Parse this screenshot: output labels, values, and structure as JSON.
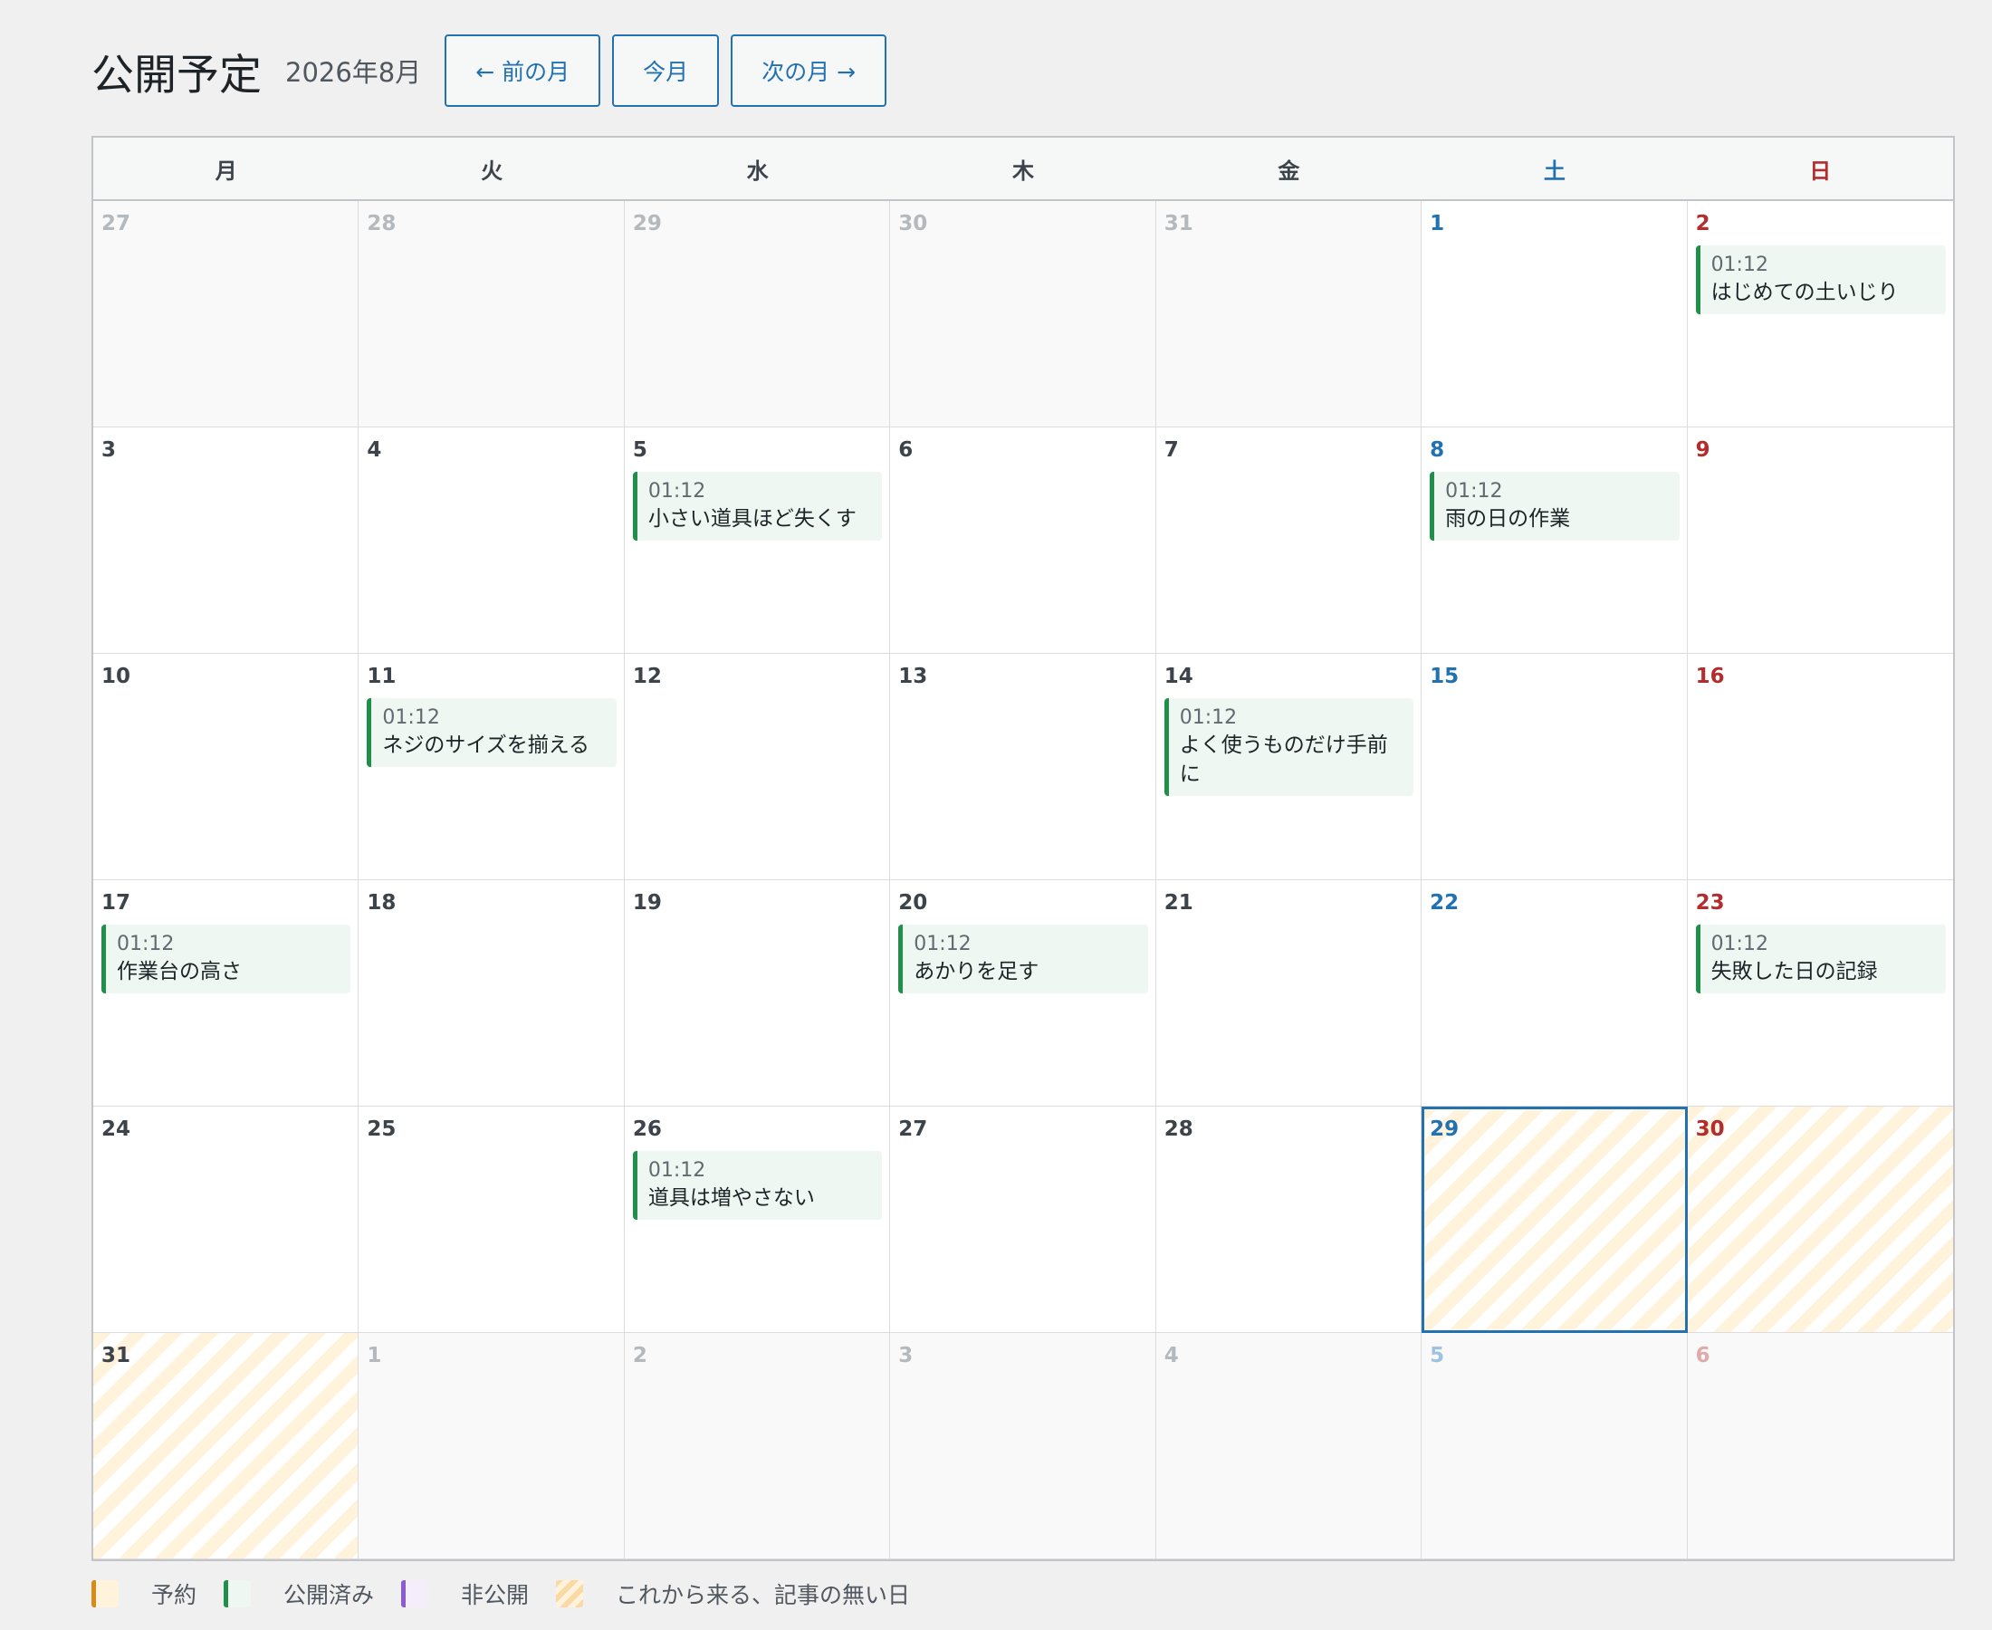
{
  "header": {
    "title": "公開予定",
    "month": "2026年8月",
    "prev_label": "← 前の月",
    "today_label": "今月",
    "next_label": "次の月 →"
  },
  "weekdays": [
    "月",
    "火",
    "水",
    "木",
    "金",
    "土",
    "日"
  ],
  "days": [
    {
      "d": "27",
      "other": true
    },
    {
      "d": "28",
      "other": true
    },
    {
      "d": "29",
      "other": true
    },
    {
      "d": "30",
      "other": true
    },
    {
      "d": "31",
      "other": true
    },
    {
      "d": "1"
    },
    {
      "d": "2",
      "events": [
        {
          "time": "01:12",
          "title": "はじめての土いじり"
        }
      ]
    },
    {
      "d": "3"
    },
    {
      "d": "4"
    },
    {
      "d": "5",
      "events": [
        {
          "time": "01:12",
          "title": "小さい道具ほど失くす"
        }
      ]
    },
    {
      "d": "6"
    },
    {
      "d": "7"
    },
    {
      "d": "8",
      "events": [
        {
          "time": "01:12",
          "title": "雨の日の作業"
        }
      ]
    },
    {
      "d": "9"
    },
    {
      "d": "10"
    },
    {
      "d": "11",
      "events": [
        {
          "time": "01:12",
          "title": "ネジのサイズを揃える"
        }
      ]
    },
    {
      "d": "12"
    },
    {
      "d": "13"
    },
    {
      "d": "14",
      "events": [
        {
          "time": "01:12",
          "title": "よく使うものだけ手前に"
        }
      ]
    },
    {
      "d": "15"
    },
    {
      "d": "16"
    },
    {
      "d": "17",
      "events": [
        {
          "time": "01:12",
          "title": "作業台の高さ"
        }
      ]
    },
    {
      "d": "18"
    },
    {
      "d": "19"
    },
    {
      "d": "20",
      "events": [
        {
          "time": "01:12",
          "title": "あかりを足す"
        }
      ]
    },
    {
      "d": "21"
    },
    {
      "d": "22"
    },
    {
      "d": "23",
      "events": [
        {
          "time": "01:12",
          "title": "失敗した日の記録"
        }
      ]
    },
    {
      "d": "24"
    },
    {
      "d": "25"
    },
    {
      "d": "26",
      "events": [
        {
          "time": "01:12",
          "title": "道具は増やさない"
        }
      ]
    },
    {
      "d": "27"
    },
    {
      "d": "28"
    },
    {
      "d": "29",
      "today": true,
      "future_empty": true
    },
    {
      "d": "30",
      "future_empty": true
    },
    {
      "d": "31",
      "future_empty": true
    },
    {
      "d": "1",
      "other": true
    },
    {
      "d": "2",
      "other": true
    },
    {
      "d": "3",
      "other": true
    },
    {
      "d": "4",
      "other": true
    },
    {
      "d": "5",
      "other": true
    },
    {
      "d": "6",
      "other": true
    }
  ],
  "legend": [
    {
      "key": "scheduled",
      "label": "予約"
    },
    {
      "key": "published",
      "label": "公開済み"
    },
    {
      "key": "private",
      "label": "非公開"
    },
    {
      "key": "future",
      "label": "これから来る、記事の無い日"
    }
  ],
  "colors": {
    "accent": "#2271b1",
    "saturday": "#2271b1",
    "sunday": "#b32d2e",
    "published": "#1f8f4a",
    "scheduled": "#d98b1a",
    "private": "#8a5bd1"
  }
}
